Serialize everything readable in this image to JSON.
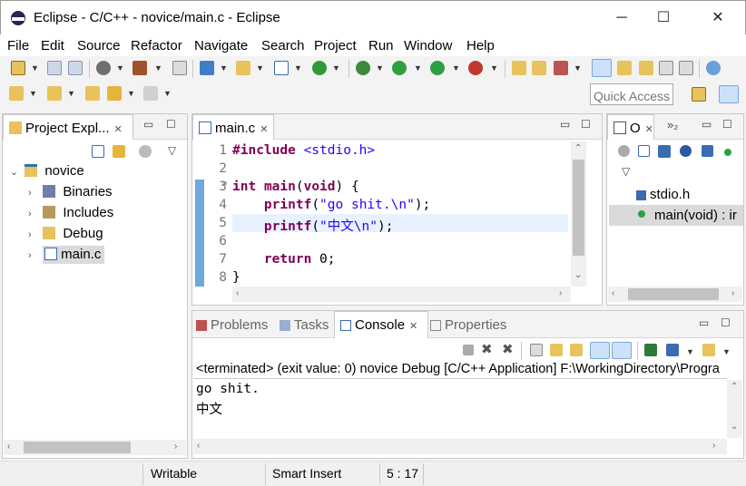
{
  "window": {
    "title": "Eclipse - C/C++ - novice/main.c - Eclipse",
    "minimize": "─",
    "maximize": "☐",
    "close": "✕"
  },
  "menu": [
    "File",
    "Edit",
    "Source",
    "Refactor",
    "Navigate",
    "Search",
    "Project",
    "Run",
    "Window",
    "Help"
  ],
  "quick_access": {
    "placeholder": "Quick Access"
  },
  "project_explorer": {
    "tab_label": "Project Expl...",
    "tree": [
      {
        "label": "novice",
        "icon": "project-folder-icon"
      },
      {
        "label": "Binaries",
        "icon": "binaries-icon"
      },
      {
        "label": "Includes",
        "icon": "includes-icon"
      },
      {
        "label": "Debug",
        "icon": "folder-icon"
      },
      {
        "label": "main.c",
        "icon": "c-file-icon"
      }
    ]
  },
  "editor": {
    "tab_label": "main.c",
    "lines": [
      {
        "num": "1"
      },
      {
        "num": "2"
      },
      {
        "num": "3"
      },
      {
        "num": "4"
      },
      {
        "num": "5"
      },
      {
        "num": "6"
      },
      {
        "num": "7"
      },
      {
        "num": "8"
      }
    ],
    "tokens": {
      "l1_kw": "#include",
      "l1_str": " <stdio.h>",
      "l3_kw1": "int",
      "l3_kw2": "main",
      "l3_p": "(",
      "l3_kw3": "void",
      "l3_rest": ") {",
      "l4_kw": "printf",
      "l4_p": "(",
      "l4_str": "\"go shit.\\n\"",
      "l4_rest": ");",
      "l5_kw": "printf",
      "l5_p": "(",
      "l5_str": "\"中文\\n\"",
      "l5_rest": ");",
      "l7_kw": "return",
      "l7_rest": " 0;",
      "l8": "}"
    }
  },
  "outline": {
    "tab_label": "O",
    "overflow": "»₂",
    "items": [
      {
        "label": "stdio.h"
      },
      {
        "label": "main(void) : ir"
      }
    ]
  },
  "bottom_tabs": {
    "problems": "Problems",
    "tasks": "Tasks",
    "console": "Console",
    "properties": "Properties"
  },
  "console": {
    "header": "<terminated> (exit value: 0) novice Debug [C/C++ Application] F:\\WorkingDirectory\\Progra",
    "output": [
      "go shit.",
      "中文"
    ]
  },
  "status": {
    "writable": "Writable",
    "insert_mode": "Smart Insert",
    "position": "5 : 17"
  },
  "colors": {
    "keyword": "#7f0055",
    "string": "#2a00ff",
    "current_line": "#e8f2fe",
    "selection": "#dadada"
  }
}
